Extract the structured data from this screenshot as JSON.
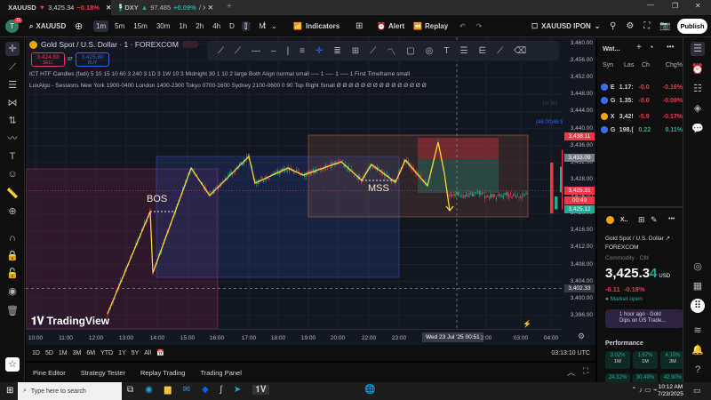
{
  "tabs": [
    {
      "symbol": "XAUUSD",
      "arrow": "▼",
      "price": "3,425.34",
      "change": "−0.18%"
    },
    {
      "symbol": "DXY",
      "arrow": "▲",
      "price": "97.485",
      "change": "+0.09%",
      "suffix": "/ XAUU"
    }
  ],
  "toolbar": {
    "avatar_badge": "11",
    "symbol": "XAUUSD",
    "timeframes": [
      "1m",
      "5m",
      "15m",
      "30m",
      "1h",
      "2h",
      "4h",
      "D",
      "W",
      "M"
    ],
    "selected_tf": "1m",
    "indicators": "Indicators",
    "alert": "Alert",
    "replay": "Replay",
    "layout": "XAUUSD IPON",
    "publish": "Publish"
  },
  "chart": {
    "title": "Gold Spot / U.S. Dollar · 1 · FOREXCOM",
    "sell_price": "3,424.83",
    "sell_label": "SELL",
    "spread": "97",
    "buy_price": "3,425.80",
    "buy_label": "BUY",
    "indicator1": "ICT HTF Candles (fadi) 5 10 15 10 60 3 240 3 1D 3 1W 10 3 Midnight 30 1 10 2 large Both Align normal small ── 1 ── 1 ── 1 First Timeframe small",
    "indicator2": "LuxAlgo - Sessions New York 1900-0400 London 1400-2300 Tokyo 0700-1600 Sydney 2100-0600 0 90 Top Right Small  Ø Ø Ø Ø Ø Ø Ø Ø Ø Ø Ø Ø Ø Ø Ø",
    "bos": "BOS",
    "mss": "MSS",
    "htf_label": "1H 4H",
    "htf_timer": "(46:00)46:5",
    "watermark": "TradingView"
  },
  "price_axis": {
    "ticks": [
      "3,460.00",
      "3,456.00",
      "3,452.00",
      "3,448.00",
      "3,444.00",
      "3,440.00",
      "3,436.00",
      "3,432.00",
      "3,428.00",
      "3,424.00",
      "3,420.00",
      "3,416.00",
      "3,412.00",
      "3,408.00",
      "3,404.00",
      "3,400.00",
      "3,396.00"
    ],
    "tick_values": [
      3460,
      3456,
      3452,
      3448,
      3444,
      3440,
      3436,
      3432,
      3428,
      3424,
      3420,
      3416,
      3412,
      3408,
      3404,
      3400,
      3396
    ],
    "tag_high": "3,438.11",
    "tag_gray": "3,433.09",
    "tag_last": "3,425.31",
    "tag_countdown": "00:49",
    "tag_bid": "3,425.12",
    "tag_cross": "3,402.33"
  },
  "time_axis": {
    "labels": [
      "10:00",
      "11:00",
      "12:00",
      "13:00",
      "14:00",
      "15:00",
      "16:00",
      "17:00",
      "18:00",
      "19:00",
      "20:00",
      "22:00",
      "23:00",
      "2:00",
      "03:00",
      "04:00"
    ],
    "crosshair": "Wed 23 Jul '25   00:51"
  },
  "range_bar": {
    "ranges": [
      "1D",
      "5D",
      "1M",
      "3M",
      "6M",
      "YTD",
      "1Y",
      "5Y",
      "All"
    ],
    "clock": "03:13:10 UTC"
  },
  "bottom_tabs": [
    "Pine Editor",
    "Strategy Tester",
    "Replay Trading",
    "Trading Panel"
  ],
  "watchlist": {
    "title": "Wat...",
    "columns": [
      "Syn",
      "Las",
      "Ch",
      "Chg%"
    ],
    "rows": [
      {
        "sym": "E",
        "last": "1.17:",
        "ch": "-0.0",
        "chg": "-0.16%",
        "color": "#f23645"
      },
      {
        "sym": "G",
        "last": "1.35:",
        "ch": "-0.0",
        "chg": "-0.09%",
        "color": "#f23645"
      },
      {
        "sym": "X",
        "last": "3,42!",
        "ch": "-5.9",
        "chg": "-0.17%",
        "color": "#f23645"
      },
      {
        "sym": "G",
        "last": "198.(",
        "ch": "0.22",
        "chg": "0.11%",
        "color": "#22ab94"
      }
    ]
  },
  "details": {
    "sym": "X..",
    "name": "Gold Spot / U.S. Dollar ↗ ·",
    "exchange": "FOREXCOM",
    "type": "Commodity · Cfd",
    "price_main": "3,425.3",
    "price_last_digit": "4",
    "currency": "USD",
    "change": "-6.11",
    "change_pct": "-0.18%",
    "status": "Market open",
    "news": "1 hour ago · Gold Dips on US Trade...",
    "performance_title": "Performance",
    "performance": [
      {
        "v": "3.02%",
        "p": "1W"
      },
      {
        "v": "1.67%",
        "p": "1M"
      },
      {
        "v": "4.15%",
        "p": "3M"
      },
      {
        "v": "24.32%",
        "p": ""
      },
      {
        "v": "30.49%",
        "p": ""
      },
      {
        "v": "42.90%",
        "p": ""
      }
    ]
  },
  "taskbar": {
    "search_placeholder": "Type here to search",
    "time": "10:12 AM",
    "date": "7/23/2025"
  },
  "colors": {
    "up": "#22ab94",
    "down": "#f23645",
    "zigzag": "#f5d33b",
    "accent": "#2962ff"
  }
}
